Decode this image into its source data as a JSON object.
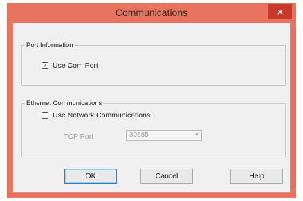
{
  "window": {
    "title": "Communications",
    "close_label": "×"
  },
  "port_information": {
    "legend": "Port Information",
    "use_com_port": {
      "label": "Use Com Port",
      "checked": true,
      "mark": "✓"
    }
  },
  "ethernet": {
    "legend": "Ethernet Communications",
    "use_network": {
      "label": "Use Network Communications",
      "checked": false
    },
    "tcp_port_label": "TCP Port",
    "tcp_port_value": "30685",
    "tcp_port_arrow": "▾"
  },
  "buttons": {
    "ok": "OK",
    "cancel": "Cancel",
    "help": "Help"
  },
  "colors": {
    "title_bar": "#e8745f",
    "close_button": "#c9392a",
    "client": "#f0f0f0"
  }
}
